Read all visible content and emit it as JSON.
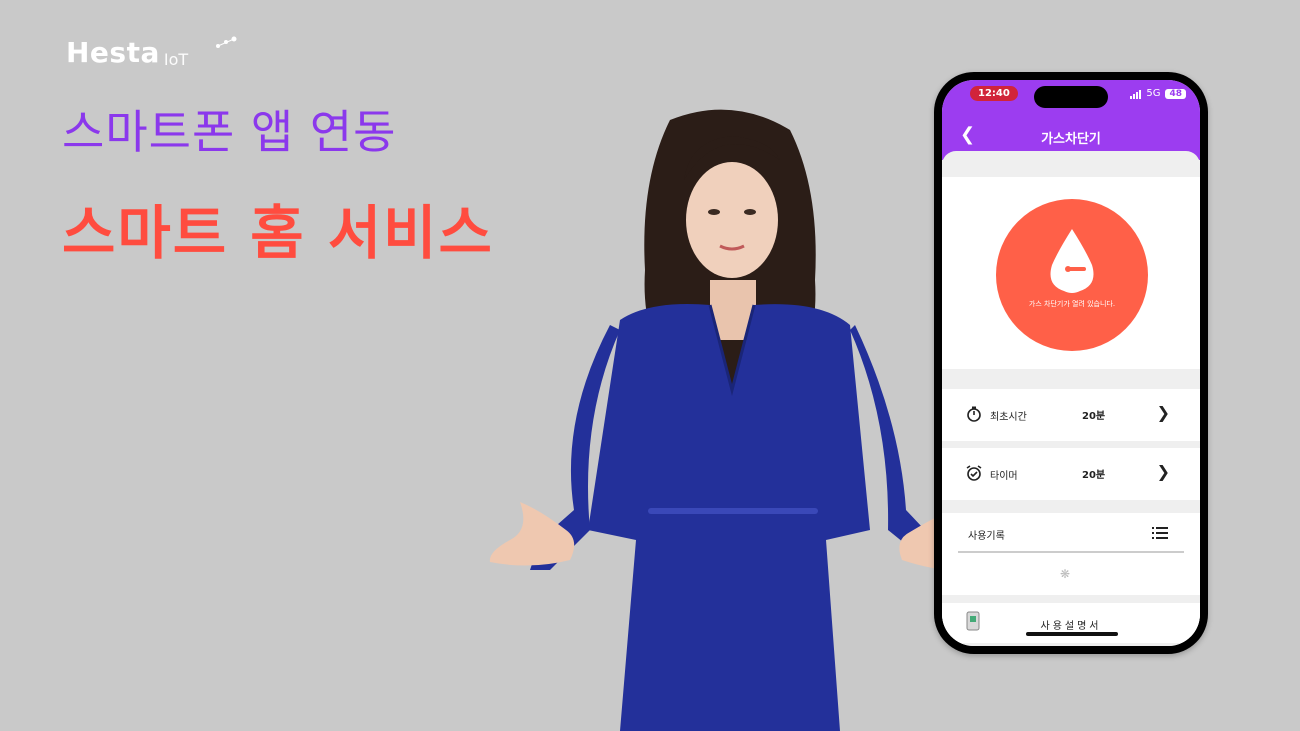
{
  "brand": {
    "name": "Hesta",
    "sub": "IoT"
  },
  "headline": {
    "line1": "스마트폰 앱 연동",
    "line2": "스마트 홈 서비스"
  },
  "colors": {
    "purple": "#9c3df0",
    "red": "#ff4c3f",
    "dial": "#ff6048"
  },
  "phone": {
    "status": {
      "time": "12:40",
      "network": "5G",
      "battery": "48"
    },
    "title": "가스차단기",
    "back_icon": "chevron-left-icon",
    "status_card": {
      "icon": "gas-drop-icon",
      "message": "가스 차단기가 열려 있습니다."
    },
    "rows": [
      {
        "icon": "stopwatch-icon",
        "label": "최초시간",
        "value": "20분"
      },
      {
        "icon": "alarm-clock-icon",
        "label": "타이머",
        "value": "20분"
      }
    ],
    "history": {
      "label": "사용기록",
      "icon": "list-icon",
      "loading_icon": "spinner-icon"
    },
    "manual": {
      "label": "사용설명서",
      "icon": "manual-icon"
    }
  }
}
